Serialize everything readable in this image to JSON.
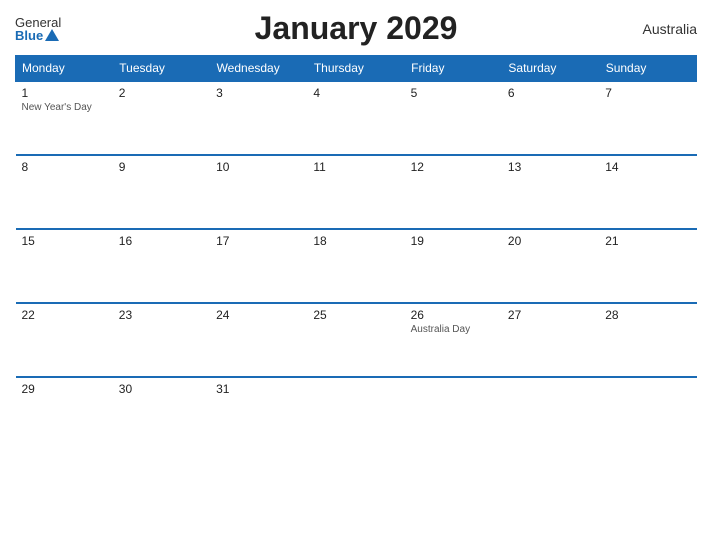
{
  "header": {
    "logo_general": "General",
    "logo_blue": "Blue",
    "title": "January 2029",
    "country": "Australia"
  },
  "days_of_week": [
    "Monday",
    "Tuesday",
    "Wednesday",
    "Thursday",
    "Friday",
    "Saturday",
    "Sunday"
  ],
  "weeks": [
    [
      {
        "day": "1",
        "holiday": "New Year's Day"
      },
      {
        "day": "2",
        "holiday": ""
      },
      {
        "day": "3",
        "holiday": ""
      },
      {
        "day": "4",
        "holiday": ""
      },
      {
        "day": "5",
        "holiday": ""
      },
      {
        "day": "6",
        "holiday": ""
      },
      {
        "day": "7",
        "holiday": ""
      }
    ],
    [
      {
        "day": "8",
        "holiday": ""
      },
      {
        "day": "9",
        "holiday": ""
      },
      {
        "day": "10",
        "holiday": ""
      },
      {
        "day": "11",
        "holiday": ""
      },
      {
        "day": "12",
        "holiday": ""
      },
      {
        "day": "13",
        "holiday": ""
      },
      {
        "day": "14",
        "holiday": ""
      }
    ],
    [
      {
        "day": "15",
        "holiday": ""
      },
      {
        "day": "16",
        "holiday": ""
      },
      {
        "day": "17",
        "holiday": ""
      },
      {
        "day": "18",
        "holiday": ""
      },
      {
        "day": "19",
        "holiday": ""
      },
      {
        "day": "20",
        "holiday": ""
      },
      {
        "day": "21",
        "holiday": ""
      }
    ],
    [
      {
        "day": "22",
        "holiday": ""
      },
      {
        "day": "23",
        "holiday": ""
      },
      {
        "day": "24",
        "holiday": ""
      },
      {
        "day": "25",
        "holiday": ""
      },
      {
        "day": "26",
        "holiday": "Australia Day"
      },
      {
        "day": "27",
        "holiday": ""
      },
      {
        "day": "28",
        "holiday": ""
      }
    ],
    [
      {
        "day": "29",
        "holiday": ""
      },
      {
        "day": "30",
        "holiday": ""
      },
      {
        "day": "31",
        "holiday": ""
      },
      {
        "day": "",
        "holiday": ""
      },
      {
        "day": "",
        "holiday": ""
      },
      {
        "day": "",
        "holiday": ""
      },
      {
        "day": "",
        "holiday": ""
      }
    ]
  ]
}
